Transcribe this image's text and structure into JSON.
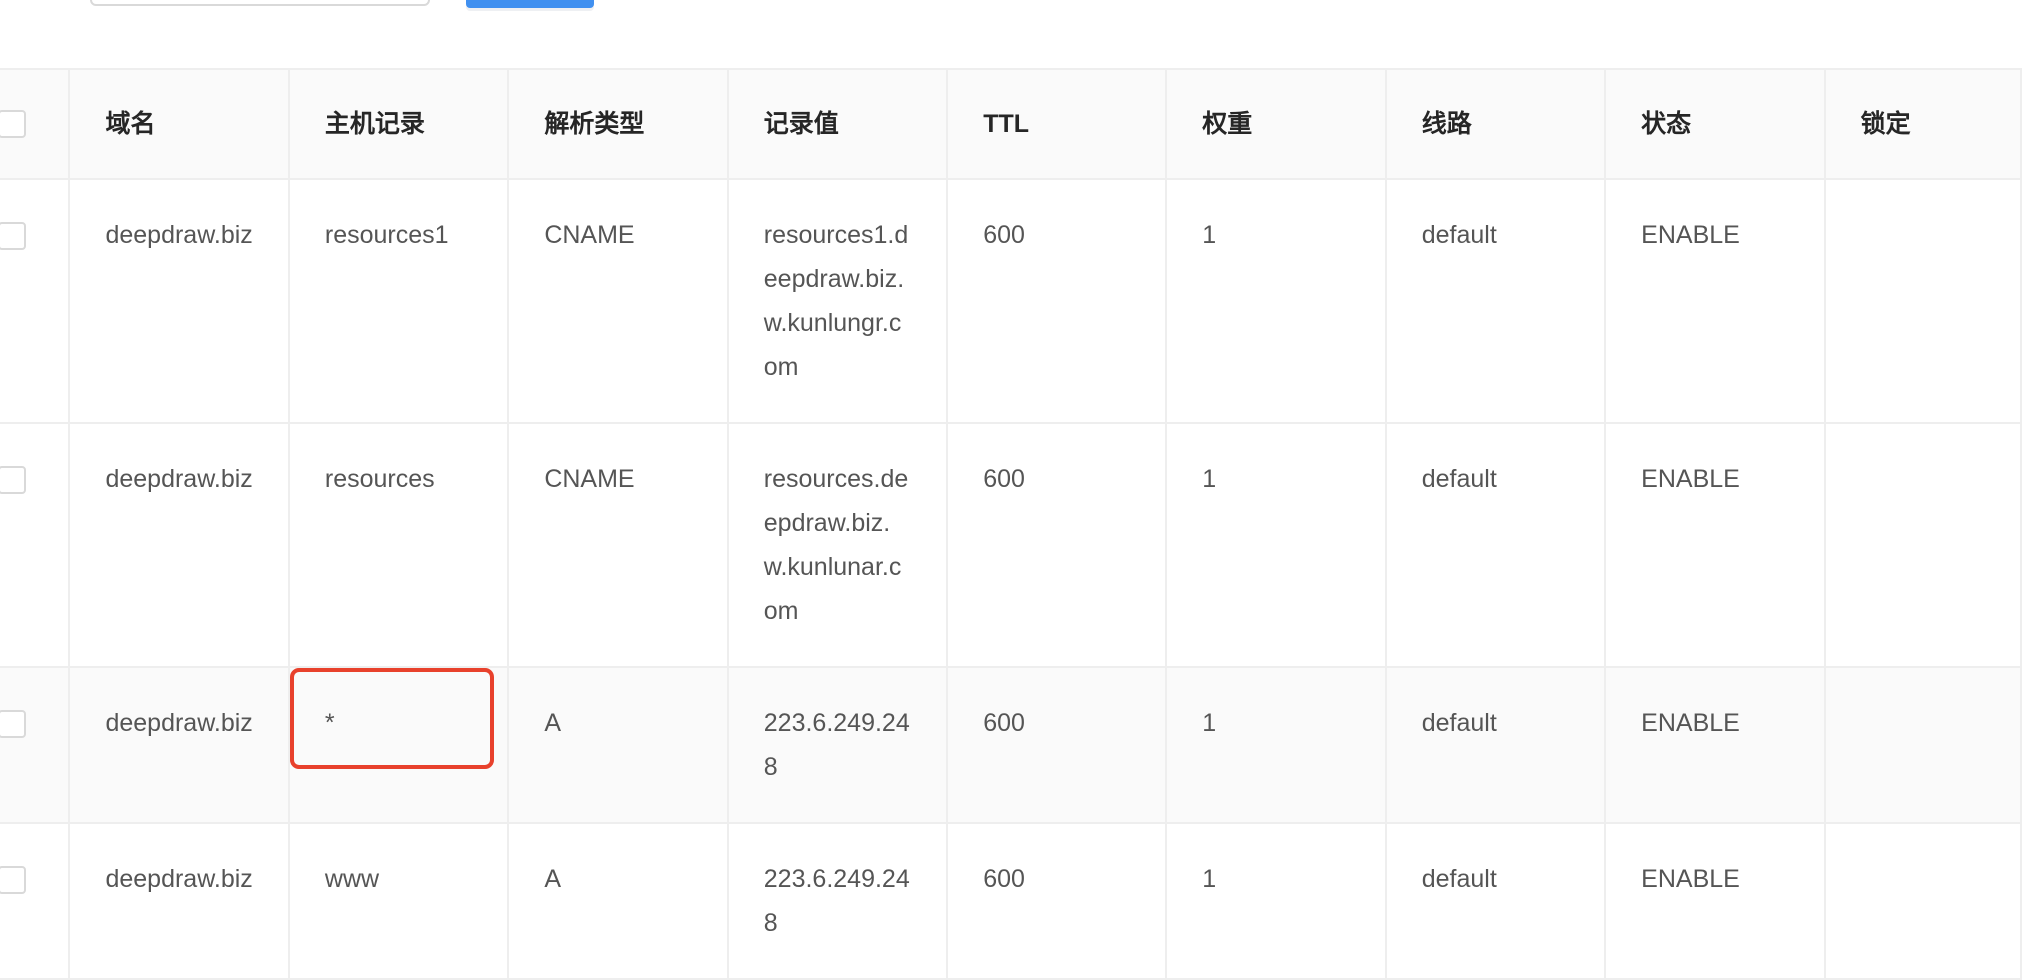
{
  "table": {
    "headers": [
      "域名",
      "主机记录",
      "解析类型",
      "记录值",
      "TTL",
      "权重",
      "线路",
      "状态",
      "锁定"
    ],
    "rows": [
      {
        "domain": "deepdraw.biz",
        "host": "resources1",
        "type": "CNAME",
        "value": "resources1.deepdraw.biz.w.kunlungr.com",
        "ttl": "600",
        "weight": "1",
        "line": "default",
        "status": "ENABLE",
        "lock": ""
      },
      {
        "domain": "deepdraw.biz",
        "host": "resources",
        "type": "CNAME",
        "value": "resources.deepdraw.biz.w.kunlunar.com",
        "ttl": "600",
        "weight": "1",
        "line": "default",
        "status": "ENABLE",
        "lock": ""
      },
      {
        "domain": "deepdraw.biz",
        "host": "*",
        "type": "A",
        "value": "223.6.249.248",
        "ttl": "600",
        "weight": "1",
        "line": "default",
        "status": "ENABLE",
        "lock": ""
      },
      {
        "domain": "deepdraw.biz",
        "host": "www",
        "type": "A",
        "value": "223.6.249.248",
        "ttl": "600",
        "weight": "1",
        "line": "default",
        "status": "ENABLE",
        "lock": ""
      }
    ]
  },
  "colors": {
    "accent": "#4090f0",
    "highlight": "#e8412c"
  }
}
